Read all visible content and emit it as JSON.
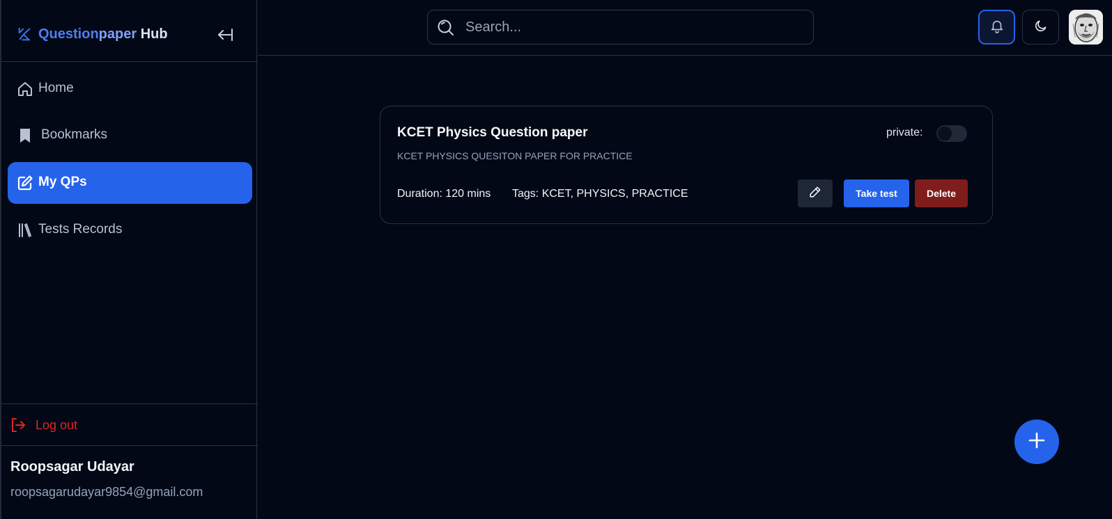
{
  "brand": {
    "part1": "Question",
    "part2": "paper",
    "part3": " Hub"
  },
  "sidebar": {
    "items": [
      {
        "label": "Home",
        "icon": "home-icon",
        "active": false
      },
      {
        "label": "Bookmarks",
        "icon": "bookmark-icon",
        "active": false
      },
      {
        "label": "My QPs",
        "icon": "edit-square-icon",
        "active": true
      },
      {
        "label": "Tests Records",
        "icon": "library-icon",
        "active": false
      }
    ],
    "logout_label": "Log out"
  },
  "user": {
    "name": "Roopsagar Udayar",
    "email": "roopsagarudayar9854@gmail.com"
  },
  "search": {
    "placeholder": "Search...",
    "value": ""
  },
  "card": {
    "title": "KCET Physics Question paper",
    "description": "KCET PHYSICS QUESITON PAPER FOR PRACTICE",
    "private_label": "private:",
    "private": false,
    "duration": "Duration: 120 mins",
    "tags": "Tags: KCET, PHYSICS, PRACTICE",
    "take_test_label": "Take test",
    "delete_label": "Delete"
  },
  "colors": {
    "accent": "#2563eb",
    "danger": "#7f1d1d",
    "logout": "#dc2626",
    "background": "#030816"
  }
}
